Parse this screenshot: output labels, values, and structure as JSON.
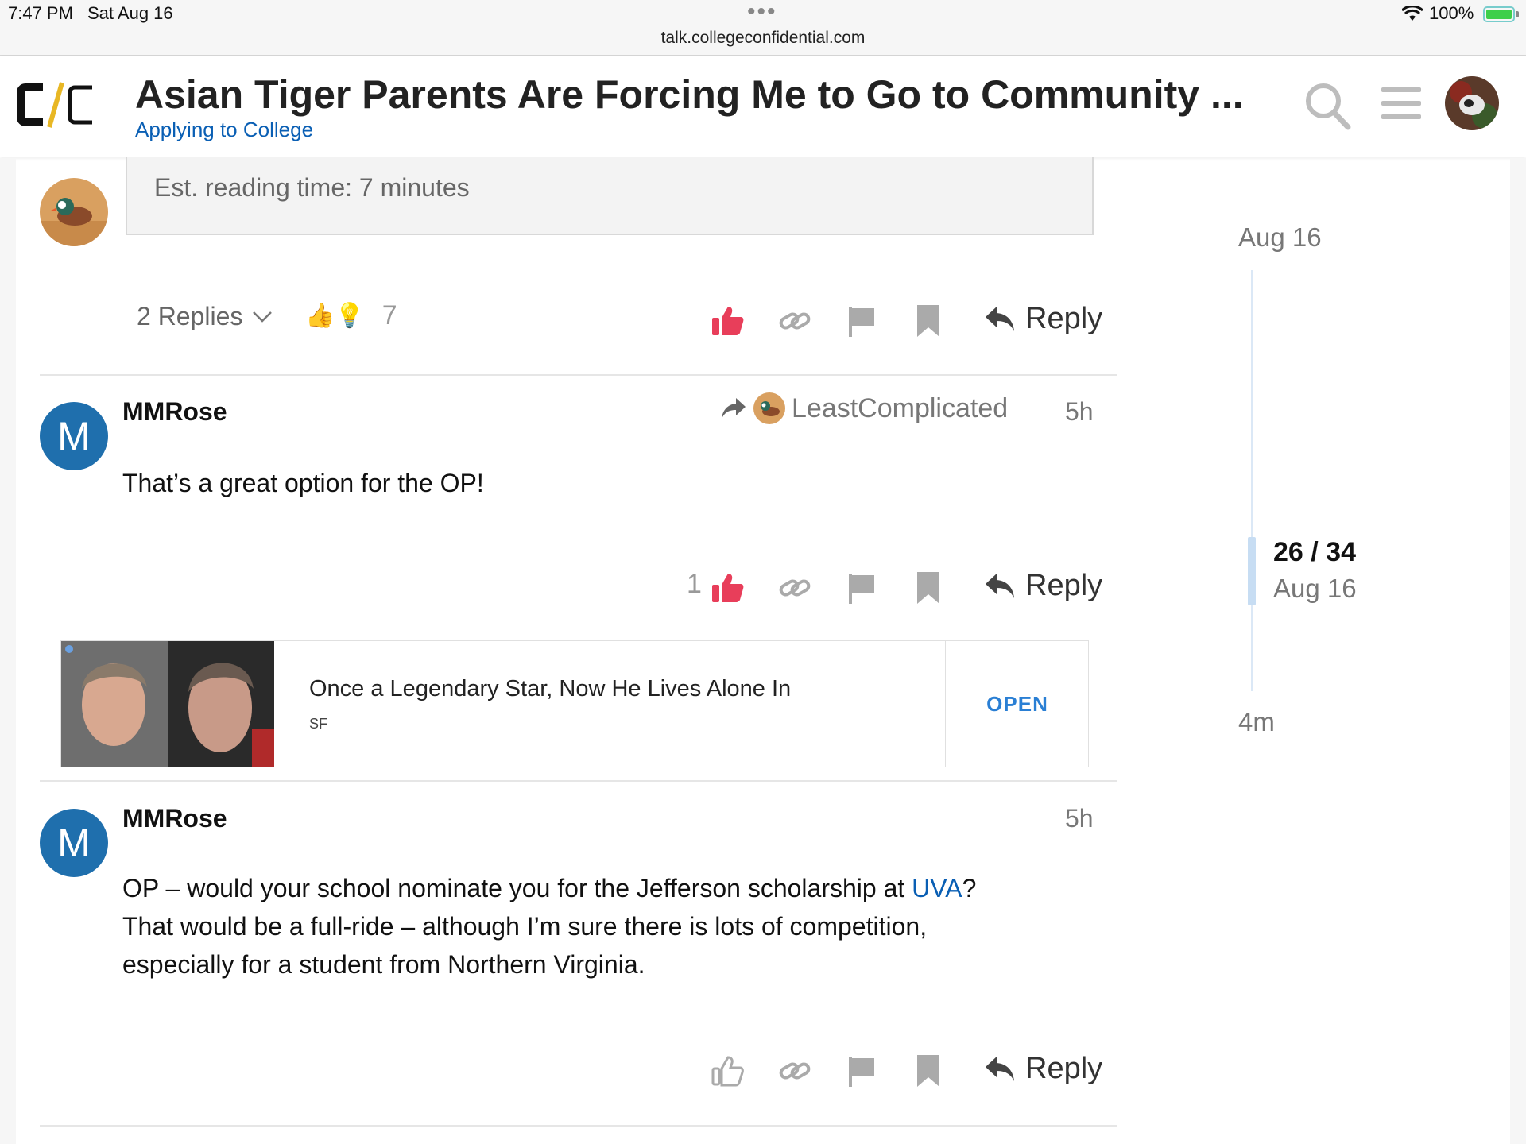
{
  "status_bar": {
    "time": "7:47 PM",
    "date": "Sat Aug 16",
    "url": "talk.collegeconfidential.com",
    "battery": "100%"
  },
  "header": {
    "title": "Asian Tiger Parents Are Forcing Me to Go to Community ...",
    "category": "Applying to College",
    "accent_color": "#0a5fb4",
    "logo_accent": "#e8b724"
  },
  "op_post": {
    "reading_time": "Est. reading time: 7 minutes",
    "replies_label": "2 Replies",
    "reactions_emoji": "👍💡",
    "reactions_count": "7",
    "reply_label": "Reply"
  },
  "posts": [
    {
      "avatar_letter": "M",
      "username": "MMRose",
      "reply_to_user": "LeastComplicated",
      "time": "5h",
      "body": "That’s a great option for the OP!",
      "like_count": "1",
      "liked": true,
      "reply_label": "Reply"
    },
    {
      "avatar_letter": "M",
      "username": "MMRose",
      "time": "5h",
      "body_before_link": "OP – would your school nominate you for the Jefferson scholarship at ",
      "body_link": "UVA",
      "body_line1_end": "?",
      "body_line2": "That would be a full-ride – although I’m sure there is lots of competition,",
      "body_line3": "especially for a student from Northern Virginia.",
      "liked": false,
      "reply_label": "Reply"
    }
  ],
  "ad": {
    "title": "Once a Legendary Star, Now He Lives Alone In",
    "source": "SF",
    "cta": "OPEN"
  },
  "timeline": {
    "top_date": "Aug 16",
    "position": "26 / 34",
    "current_date": "Aug 16",
    "bottom_label": "4m"
  },
  "icons": [
    "search-icon",
    "hamburger-menu-icon",
    "like-icon",
    "link-icon",
    "flag-icon",
    "bookmark-icon",
    "reply-arrow-icon",
    "chevron-down-icon",
    "share-arrow-icon"
  ]
}
